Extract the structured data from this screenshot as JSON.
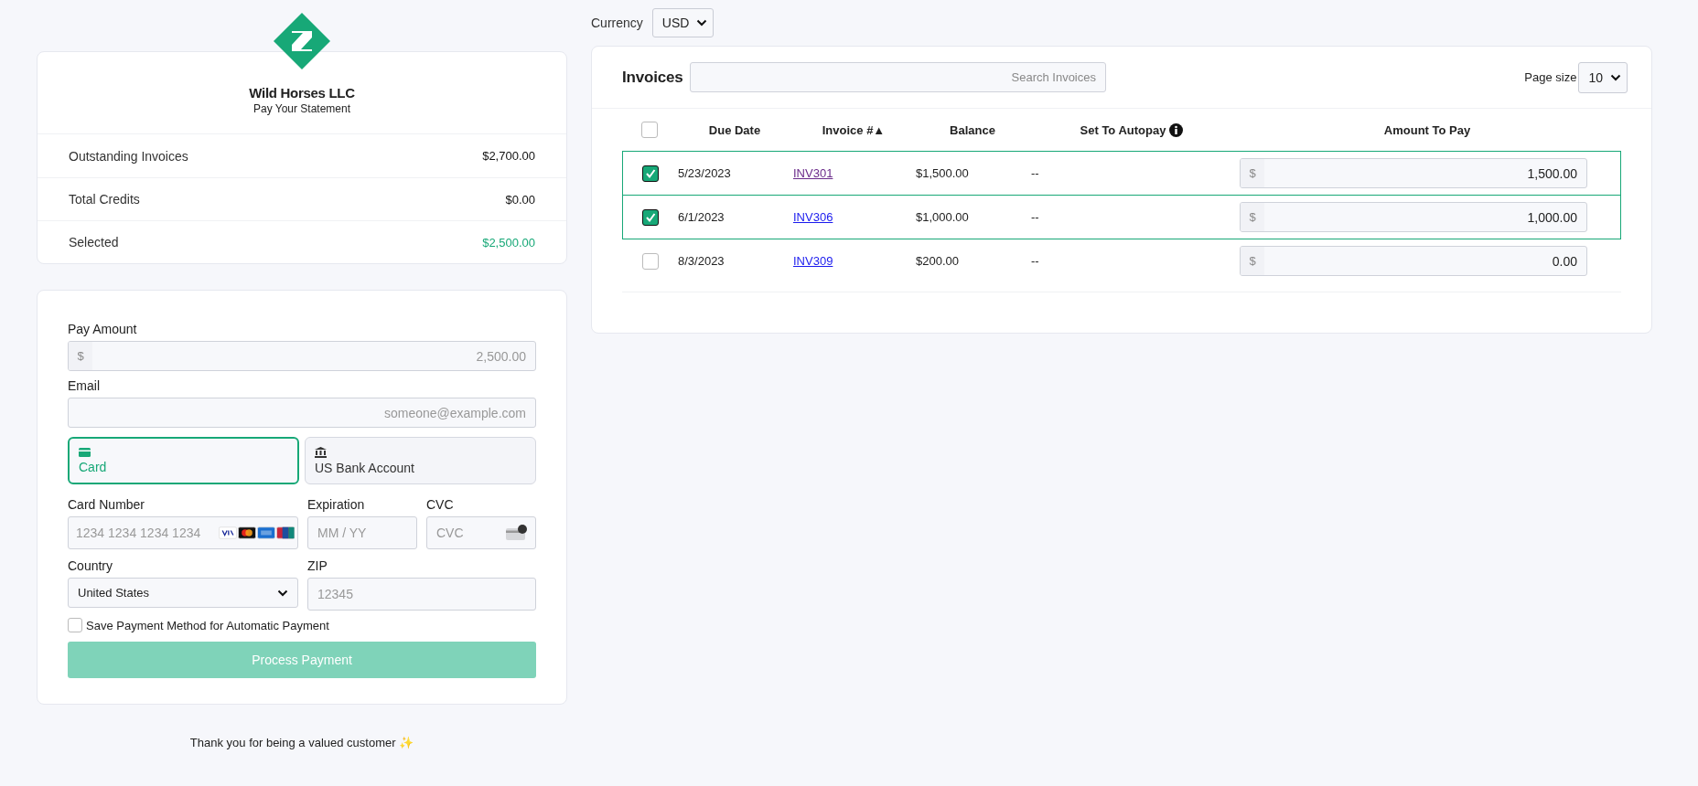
{
  "company": {
    "name": "Wild Horses LLC",
    "subtitle": "Pay Your Statement"
  },
  "summary": [
    {
      "label": "Outstanding Invoices",
      "value": "$2,700.00",
      "highlight": false
    },
    {
      "label": "Total Credits",
      "value": "$0.00",
      "highlight": false
    },
    {
      "label": "Selected",
      "value": "$2,500.00",
      "highlight": true
    }
  ],
  "payment": {
    "pay_amount": {
      "label": "Pay Amount",
      "prefix": "$",
      "placeholder": "2,500.00"
    },
    "email": {
      "label": "Email",
      "placeholder": "someone@example.com"
    },
    "methods": [
      {
        "kind": "card",
        "label": "Card",
        "selected": true
      },
      {
        "kind": "bank",
        "label": "US Bank Account",
        "selected": false
      }
    ],
    "card_number": {
      "label": "Card Number",
      "placeholder": "1234 1234 1234 1234"
    },
    "expiration": {
      "label": "Expiration",
      "placeholder": "MM / YY"
    },
    "cvc": {
      "label": "CVC",
      "placeholder": "CVC"
    },
    "country": {
      "label": "Country",
      "value": "United States"
    },
    "zip": {
      "label": "ZIP",
      "placeholder": "12345"
    },
    "save_method": {
      "label": "Save Payment Method for Automatic Payment",
      "checked": false
    },
    "submit": {
      "label": "Process Payment",
      "disabled": true
    }
  },
  "footer": "Thank you for being a valued customer ✨",
  "currency": {
    "label": "Currency",
    "value": "USD"
  },
  "invoices": {
    "title": "Invoices",
    "search_placeholder": "Search Invoices",
    "page_size": {
      "label": "Page size",
      "value": "10"
    },
    "all_checked": false,
    "columns": [
      "Due Date",
      "Invoice #▲",
      "Balance",
      "Set To Autopay",
      "Amount To Pay"
    ],
    "rows": [
      {
        "selected": true,
        "due_date": "5/23/2023",
        "invoice": "INV301",
        "visited": true,
        "balance": "$1,500.00",
        "autopay": "--",
        "prefix": "$",
        "amount": "1,500.00"
      },
      {
        "selected": true,
        "due_date": "6/1/2023",
        "invoice": "INV306",
        "visited": false,
        "balance": "$1,000.00",
        "autopay": "--",
        "prefix": "$",
        "amount": "1,000.00"
      },
      {
        "selected": false,
        "due_date": "8/3/2023",
        "invoice": "INV309",
        "visited": false,
        "balance": "$200.00",
        "autopay": "--",
        "prefix": "$",
        "amount": "0.00"
      }
    ]
  }
}
